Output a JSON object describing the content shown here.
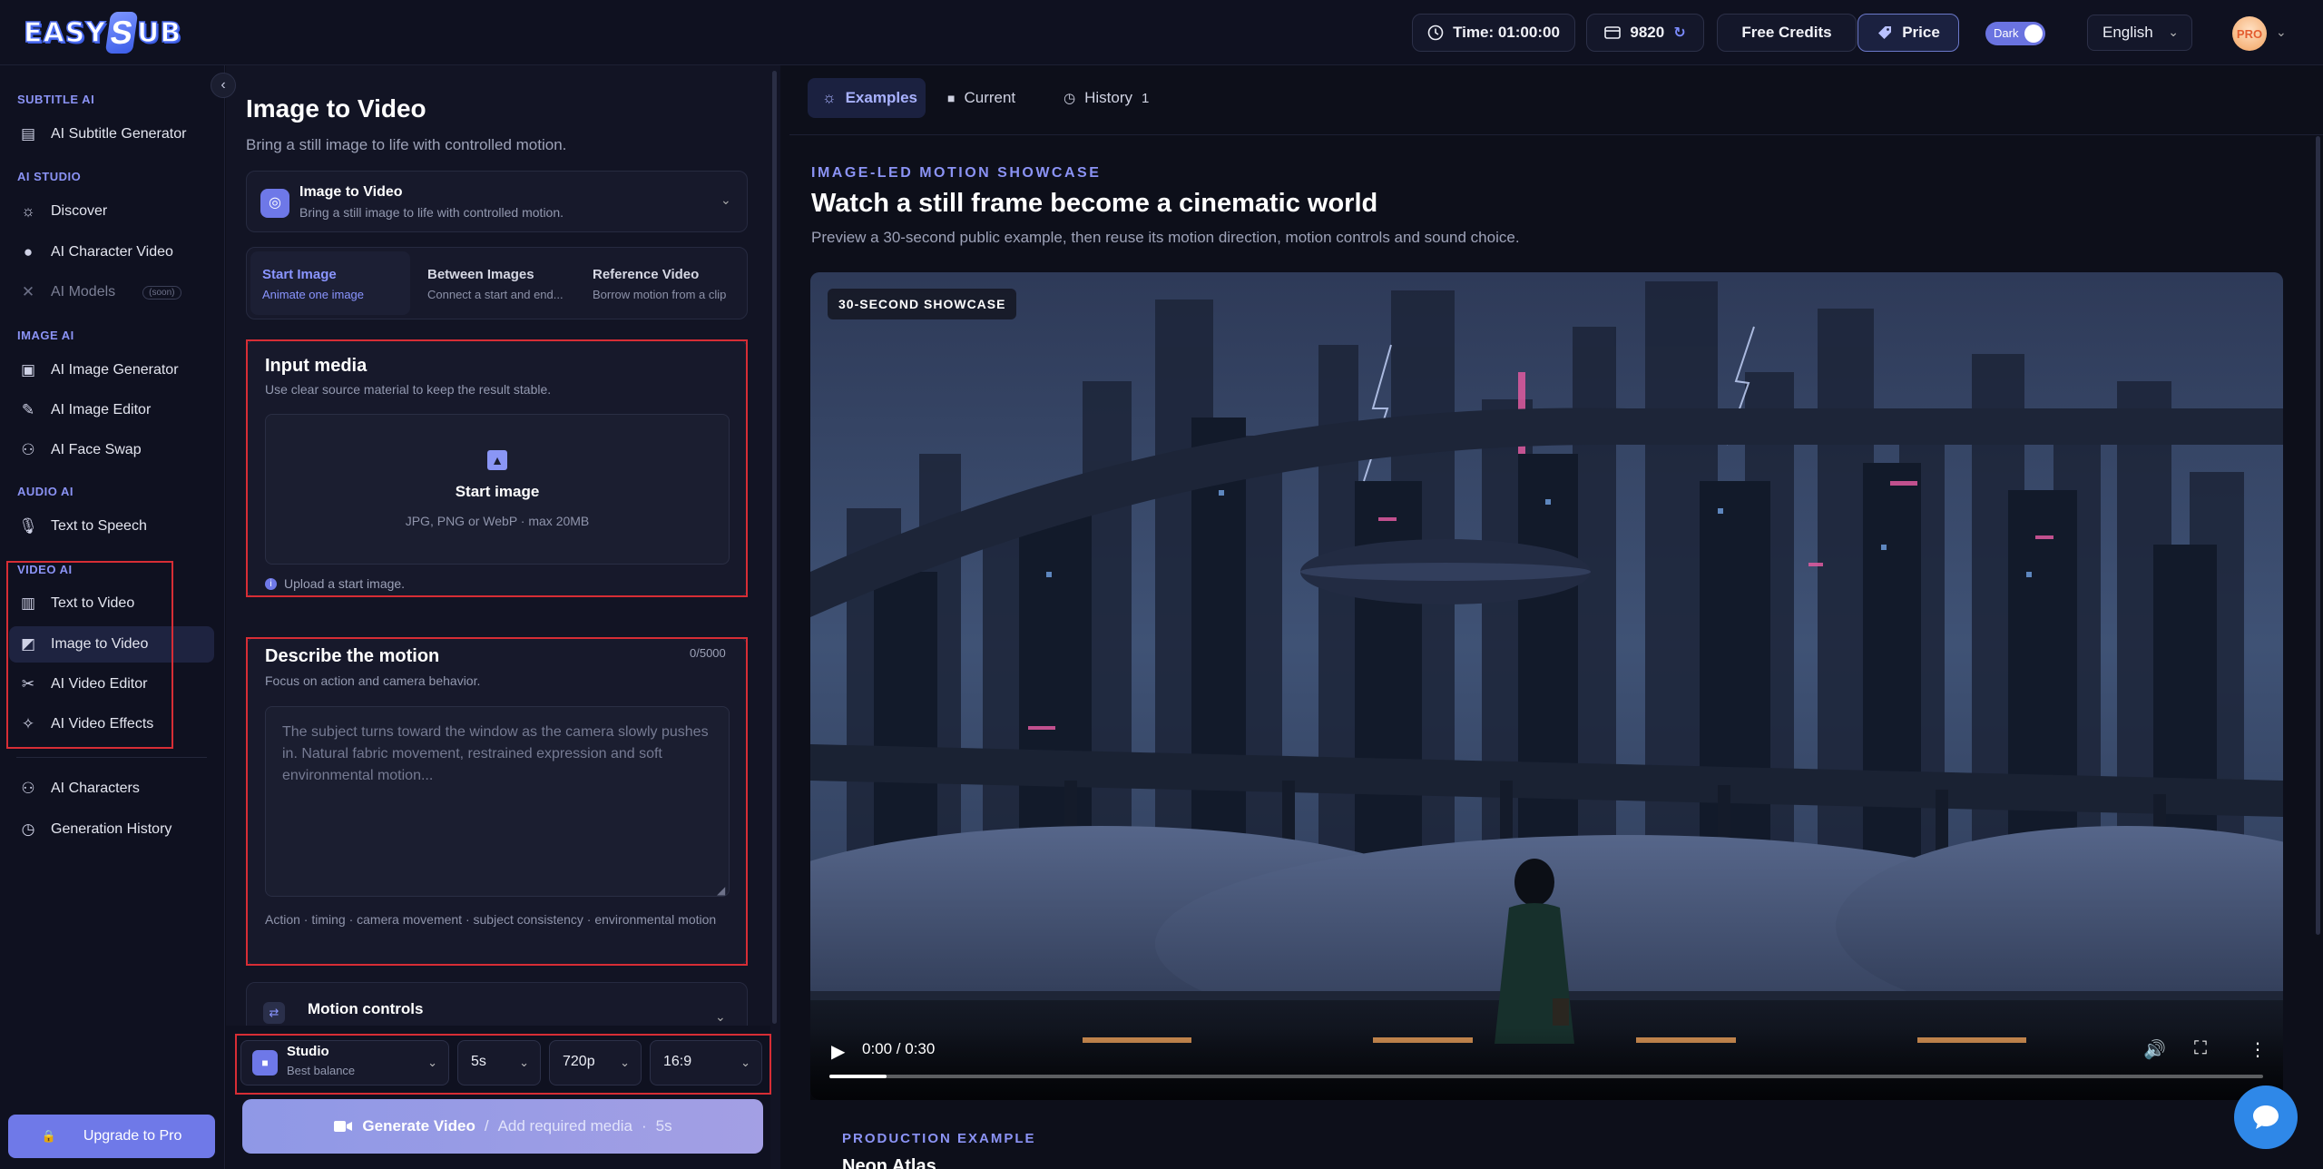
{
  "header": {
    "logo_text_left": "EASY",
    "logo_text_s": "S",
    "logo_text_right": "UB",
    "time_label": "Time: 01:00:00",
    "credits_value": "9820",
    "free_credits_label": "Free Credits",
    "price_label": "Price",
    "theme_toggle_label": "Dark",
    "language_value": "English",
    "avatar_badge": "PRO"
  },
  "sidebar": {
    "collapse_icon": "‹",
    "sections": {
      "subtitle_ai": "SUBTITLE AI",
      "ai_studio": "AI STUDIO",
      "image_ai": "IMAGE AI",
      "audio_ai": "AUDIO AI",
      "video_ai": "VIDEO AI"
    },
    "items": {
      "ai_subtitle_generator": "AI Subtitle Generator",
      "discover": "Discover",
      "ai_character_video": "AI Character Video",
      "ai_models": "AI Models",
      "ai_models_badge": "(soon)",
      "ai_image_generator": "AI Image Generator",
      "ai_image_editor": "AI Image Editor",
      "ai_face_swap": "AI Face Swap",
      "text_to_speech": "Text to Speech",
      "text_to_video": "Text to Video",
      "image_to_video": "Image to Video",
      "ai_video_editor": "AI Video Editor",
      "ai_video_effects": "AI Video Effects",
      "ai_characters": "AI Characters",
      "generation_history": "Generation History"
    },
    "upgrade_label": "Upgrade to Pro"
  },
  "form": {
    "title": "Image to Video",
    "subtitle": "Bring a still image to life with controlled motion.",
    "mode_selector": {
      "title": "Image to Video",
      "subtitle": "Bring a still image to life with controlled motion."
    },
    "tabs": [
      {
        "title": "Start Image",
        "subtitle": "Animate one image"
      },
      {
        "title": "Between Images",
        "subtitle": "Connect a start and end..."
      },
      {
        "title": "Reference Video",
        "subtitle": "Borrow motion from a clip"
      }
    ],
    "input_media": {
      "title": "Input media",
      "subtitle": "Use clear source material to keep the result stable.",
      "dropzone_title": "Start image",
      "dropzone_sub": "JPG, PNG or WebP · max 20MB",
      "hint": "Upload a start image."
    },
    "motion": {
      "title": "Describe the motion",
      "subtitle": "Focus on action and camera behavior.",
      "counter": "0/5000",
      "placeholder": "The subject turns toward the window as the camera slowly pushes in. Natural fabric movement, restrained expression and soft environmental motion...",
      "tags": "Action · timing · camera movement · subject consistency · environmental motion"
    },
    "motion_controls_title": "Motion controls",
    "settings": {
      "model_title": "Studio",
      "model_sub": "Best balance",
      "duration": "5s",
      "resolution": "720p",
      "aspect": "16:9"
    },
    "generate": {
      "label": "Generate Video",
      "separator": "/",
      "status": "Add required media",
      "dot": "·",
      "duration": "5s"
    }
  },
  "preview": {
    "tabs": {
      "examples": "Examples",
      "current": "Current",
      "history": "History",
      "history_count": "1"
    },
    "eyebrow": "IMAGE-LED MOTION SHOWCASE",
    "title": "Watch a still frame become a cinematic world",
    "subtitle": "Preview a 30-second public example, then reuse its motion direction, motion controls and sound choice.",
    "video": {
      "badge": "30-SECOND SHOWCASE",
      "time": "0:00 / 0:30",
      "progress": 0.04
    },
    "production_eyebrow": "PRODUCTION EXAMPLE",
    "production_title": "Neon Atlas"
  },
  "colors": {
    "accent": "#8b93f5",
    "highlight_border": "#d72d35",
    "chat_button": "#2f88e8"
  }
}
